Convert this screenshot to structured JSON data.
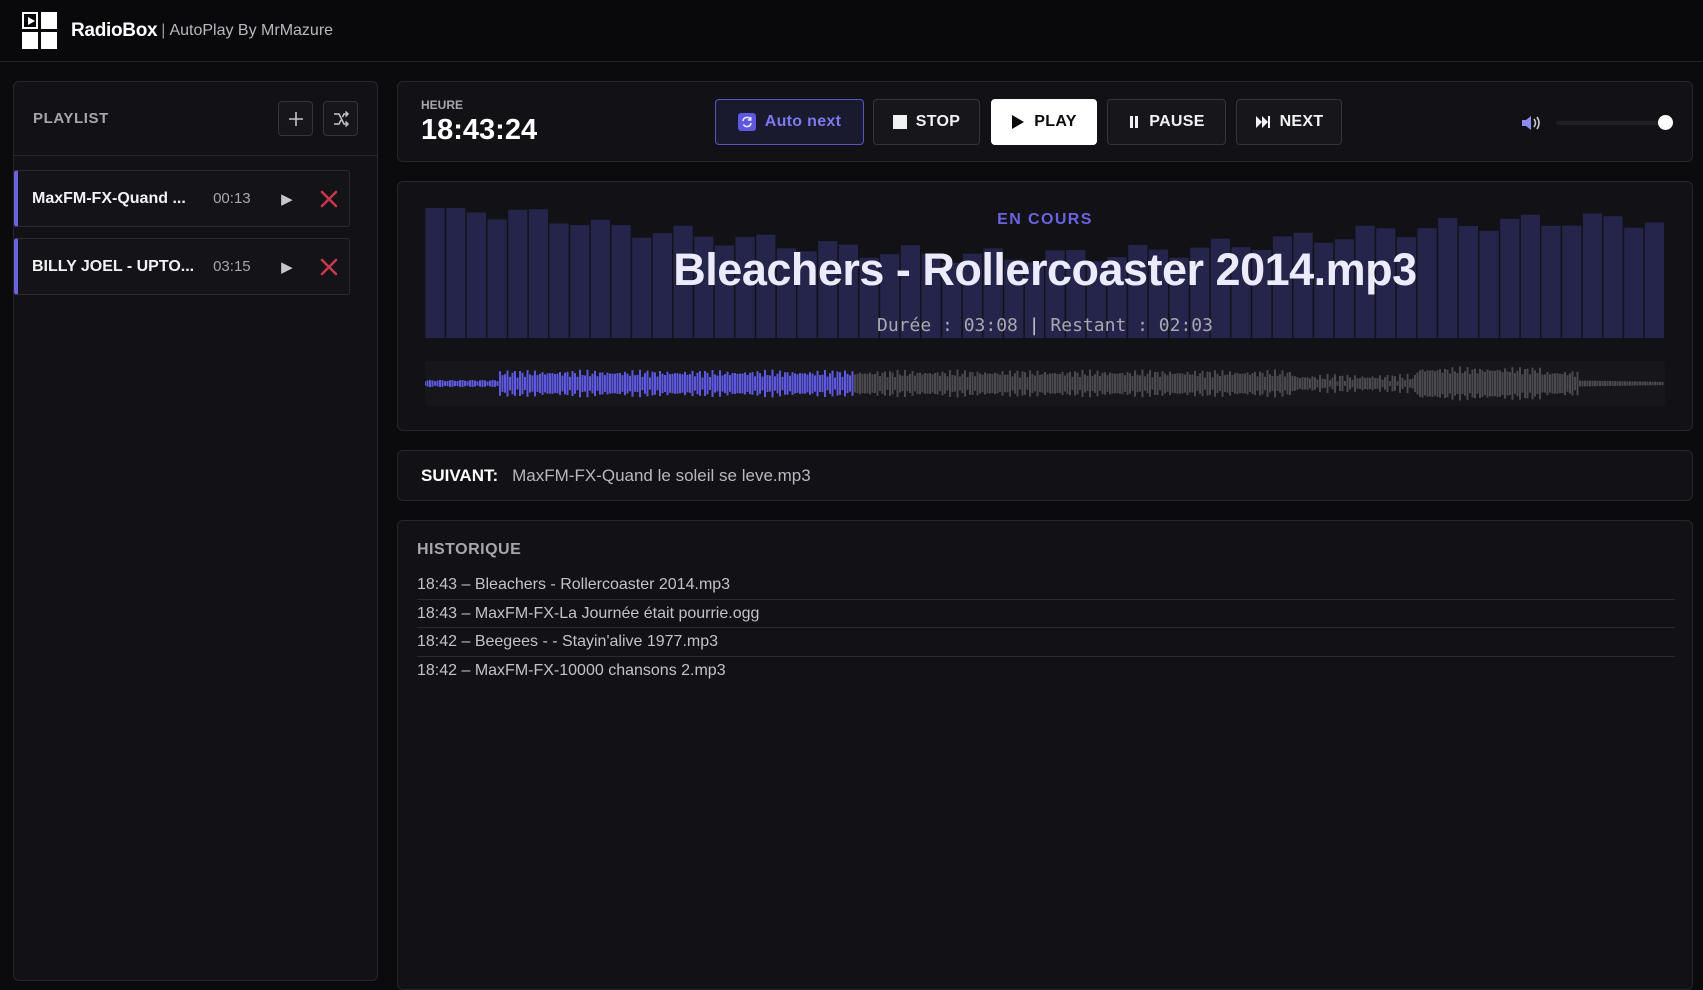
{
  "app": {
    "name": "RadioBox",
    "subtitle": "AutoPlay By MrMazure",
    "separator": "|"
  },
  "sidebar": {
    "title": "PLAYLIST",
    "add_icon": "plus-icon",
    "shuffle_icon": "shuffle-icon",
    "items": [
      {
        "name": "MaxFM-FX-Quand ...",
        "duration": "00:13",
        "play_icon": "▶",
        "delete_icon": "close-icon"
      },
      {
        "name": "BILLY JOEL - UPTO...",
        "duration": "03:15",
        "play_icon": "▶",
        "delete_icon": "close-icon"
      }
    ]
  },
  "controls": {
    "clock_label": "HEURE",
    "clock": "18:43:24",
    "auto_next": "Auto next",
    "stop": "STOP",
    "play": "PLAY",
    "pause": "PAUSE",
    "next": "NEXT",
    "volume_icon": "speaker-icon",
    "volume_level": 0.93
  },
  "now_playing": {
    "label": "EN COURS",
    "title": "Bleachers - Rollercoaster 2014.mp3",
    "duration_label": "Durée : 03:08",
    "separator": "|",
    "remaining_label": "Restant : 02:03",
    "progress": 0.345
  },
  "next_track": {
    "label": "SUIVANT:",
    "value": "MaxFM-FX-Quand le soleil se leve.mp3"
  },
  "history": {
    "title": "HISTORIQUE",
    "items": [
      "18:43 – Bleachers - Rollercoaster 2014.mp3",
      "18:43 – MaxFM-FX-La Journée était pourrie.ogg",
      "18:42 – Beegees - - Stayin'alive 1977.mp3",
      "18:42 – MaxFM-FX-10000 chansons 2.mp3"
    ]
  },
  "colors": {
    "accent": "#6a63e0",
    "visualizer_bar": "#25244a",
    "wave_played": "#5e58e0",
    "wave_unplayed": "#4a4a4e",
    "delete": "#c8384c"
  }
}
